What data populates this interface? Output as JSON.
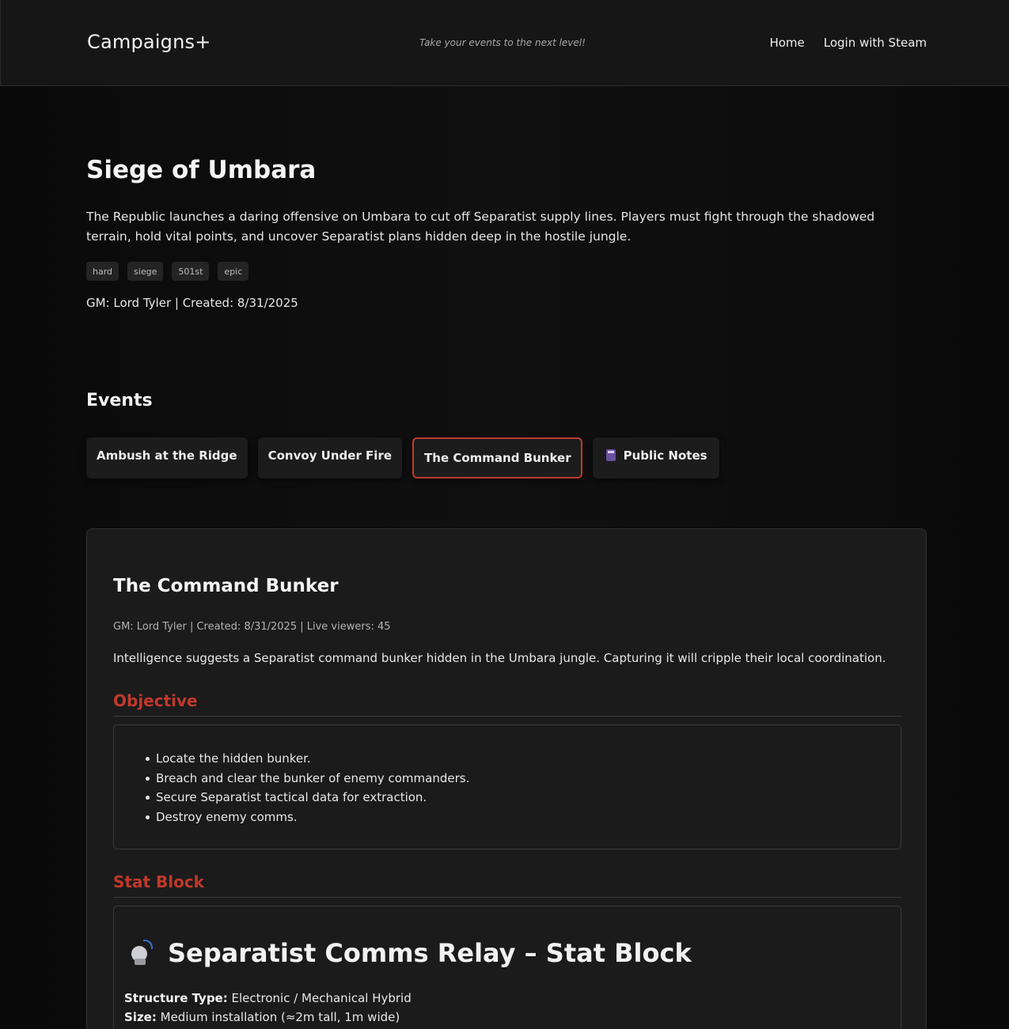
{
  "header": {
    "brand": "Campaigns+",
    "tagline": "Take your events to the next level!",
    "nav": [
      {
        "label": "Home"
      },
      {
        "label": "Login with Steam"
      }
    ]
  },
  "campaign": {
    "title": "Siege of Umbara",
    "description": "The Republic launches a daring offensive on Umbara to cut off Separatist supply lines. Players must fight through the shadowed terrain, hold vital points, and uncover Separatist plans hidden deep in the hostile jungle.",
    "tags": [
      "hard",
      "siege",
      "501st",
      "epic"
    ],
    "meta": "GM: Lord Tyler | Created: 8/31/2025"
  },
  "events": {
    "heading": "Events",
    "tabs": [
      {
        "label": "Ambush at the Ridge",
        "active": false
      },
      {
        "label": "Convoy Under Fire",
        "active": false
      },
      {
        "label": "The Command Bunker",
        "active": true
      },
      {
        "label": "Public Notes",
        "icon": "notebook-icon",
        "active": false
      }
    ]
  },
  "event_detail": {
    "title": "The Command Bunker",
    "meta": "GM: Lord Tyler | Created: 8/31/2025 | Live viewers: 45",
    "description": "Intelligence suggests a Separatist command bunker hidden in the Umbara jungle. Capturing it will cripple their local coordination.",
    "objective_heading": "Objective",
    "objectives": [
      "Locate the hidden bunker.",
      "Breach and clear the bunker of enemy commanders.",
      "Secure Separatist tactical data for extraction.",
      "Destroy enemy comms."
    ],
    "statblock_heading": "Stat Block",
    "statblock": {
      "icon": "satellite-dish-icon",
      "title": "Separatist Comms Relay – Stat Block",
      "structure_type_label": "Structure Type:",
      "structure_type_value": " Electronic / Mechanical Hybrid",
      "size_label": "Size:",
      "size_value": " Medium installation (≈2m tall, 1m wide)"
    }
  },
  "colors": {
    "accent": "#c0392b",
    "background": "#0b0b0b",
    "card": "#1b1b1b"
  }
}
